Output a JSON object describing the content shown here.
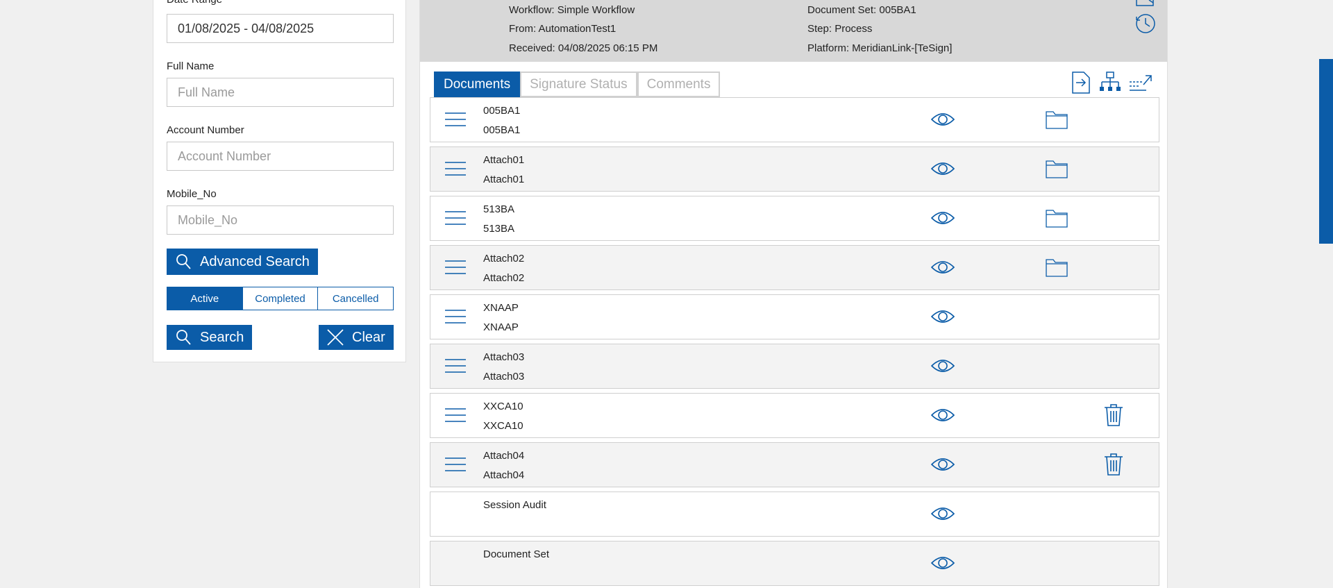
{
  "search": {
    "date_range": {
      "label": "Date Range",
      "value": "01/08/2025 - 04/08/2025"
    },
    "full_name": {
      "label": "Full Name",
      "placeholder": "Full Name",
      "value": ""
    },
    "account_number": {
      "label": "Account Number",
      "placeholder": "Account Number",
      "value": ""
    },
    "mobile_no": {
      "label": "Mobile_No",
      "placeholder": "Mobile_No",
      "value": ""
    },
    "advanced_search_label": "Advanced Search",
    "status_filters": [
      {
        "label": "Active",
        "selected": true
      },
      {
        "label": "Completed",
        "selected": false
      },
      {
        "label": "Cancelled",
        "selected": false
      }
    ],
    "search_label": "Search",
    "clear_label": "Clear"
  },
  "info": {
    "workflow": "Workflow: Simple Workflow",
    "from": "From: AutomationTest1",
    "received": "Received: 04/08/2025 06:15 PM",
    "document_set": "Document Set: 005BA1",
    "step": "Step: Process",
    "platform": "Platform: MeridianLink-[TeSign]"
  },
  "tabs": [
    {
      "label": "Documents",
      "active": true
    },
    {
      "label": "Signature Status",
      "active": false
    },
    {
      "label": "Comments",
      "active": false
    }
  ],
  "documents": [
    {
      "line1": "005BA1",
      "line2": "005BA1",
      "action": "folder"
    },
    {
      "line1": "Attach01",
      "line2": "Attach01",
      "action": "folder"
    },
    {
      "line1": "513BA",
      "line2": "513BA",
      "action": "folder"
    },
    {
      "line1": "Attach02",
      "line2": "Attach02",
      "action": "folder"
    },
    {
      "line1": "XNAAP",
      "line2": "XNAAP",
      "action": "none"
    },
    {
      "line1": "Attach03",
      "line2": "Attach03",
      "action": "none"
    },
    {
      "line1": "XXCA10",
      "line2": "XXCA10",
      "action": "trash"
    },
    {
      "line1": "Attach04",
      "line2": "Attach04",
      "action": "trash"
    },
    {
      "line1": "Session Audit",
      "line2": "",
      "action": "none",
      "no_handle": true
    },
    {
      "line1": "Document Set",
      "line2": "",
      "action": "none",
      "no_handle": true
    }
  ],
  "colors": {
    "accent": "#0b5ca8",
    "info_bar_bg": "#d8d8d8",
    "row_alt_bg": "#f3f3f3",
    "page_bg": "#f0f0f0"
  },
  "icons": {
    "toolbar": [
      "export-icon",
      "hierarchy-icon",
      "expand-arrow-icon"
    ],
    "header": [
      "history-icon"
    ],
    "row": [
      "drag-handle-icon",
      "eye-icon",
      "folder-icon",
      "trash-icon"
    ]
  }
}
